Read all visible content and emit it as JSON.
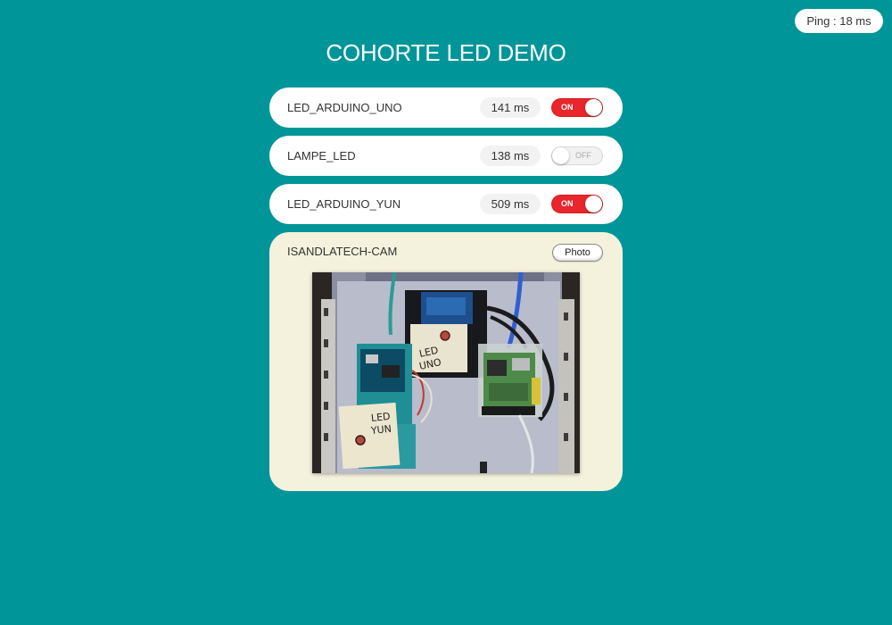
{
  "ping": {
    "label": "Ping : 18 ms"
  },
  "title": "COHORTE LED DEMO",
  "devices": [
    {
      "name": "LED_ARDUINO_UNO",
      "latency": "141 ms",
      "state": "ON"
    },
    {
      "name": "LAMPE_LED",
      "latency": "138 ms",
      "state": "OFF"
    },
    {
      "name": "LED_ARDUINO_YUN",
      "latency": "509 ms",
      "state": "ON"
    }
  ],
  "camera": {
    "name": "ISANDLATECH-CAM",
    "photo_button": "Photo",
    "feed": {
      "sticker_uno": [
        "LED",
        "UNO"
      ],
      "sticker_yun": [
        "LED",
        "YUN"
      ]
    }
  },
  "colors": {
    "background": "#009598",
    "toggle_on": "#e8262b",
    "camera_card": "#f4f2dd"
  }
}
